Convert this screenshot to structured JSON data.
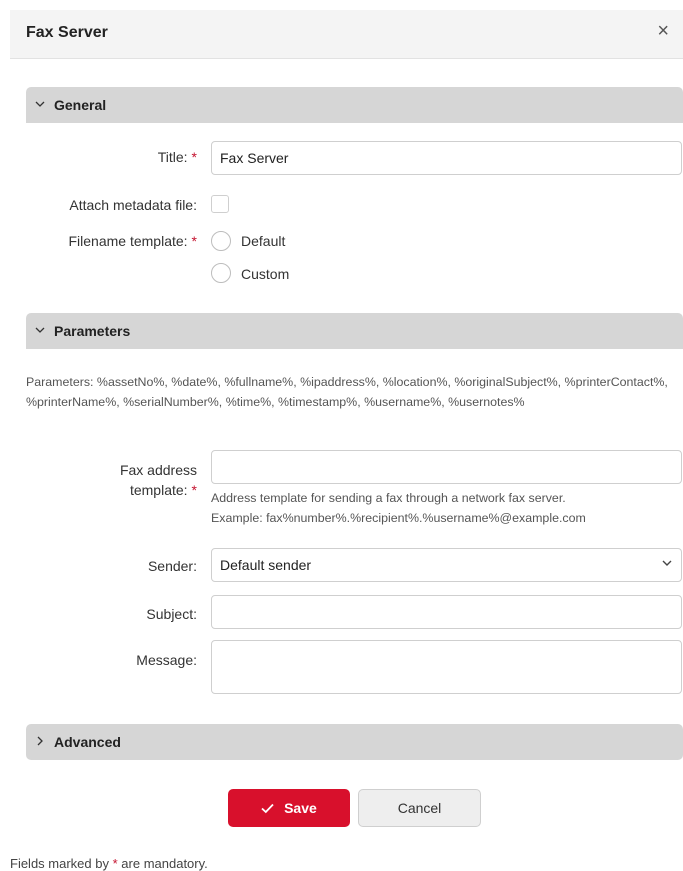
{
  "dialog": {
    "title": "Fax Server",
    "close_symbol": "×"
  },
  "general": {
    "header": "General",
    "title_label": "Title:",
    "title_value": "Fax Server",
    "attach_label": "Attach metadata file:",
    "filename_label": "Filename template:",
    "option_default": "Default",
    "option_custom": "Custom"
  },
  "parameters": {
    "header": "Parameters",
    "list_text": "Parameters: %assetNo%, %date%, %fullname%, %ipaddress%, %location%, %originalSubject%, %printerContact%, %printerName%, %serialNumber%, %time%, %timestamp%, %username%, %usernotes%",
    "fax_label_line1": "Fax address",
    "fax_label_line2": "template:",
    "fax_value": "",
    "fax_hint_line1": "Address template for sending a fax through a network fax server.",
    "fax_hint_line2": "Example: fax%number%.%recipient%.%username%@example.com",
    "sender_label": "Sender:",
    "sender_value": "Default sender",
    "subject_label": "Subject:",
    "subject_value": "",
    "message_label": "Message:",
    "message_value": ""
  },
  "advanced": {
    "header": "Advanced"
  },
  "buttons": {
    "save": "Save",
    "cancel": "Cancel"
  },
  "footer": {
    "note_prefix": "Fields marked by",
    "note_star": "*",
    "note_suffix": "are mandatory."
  },
  "required_marker": "*",
  "colors": {
    "accent": "#d8102c",
    "required": "#c4122f",
    "section_bg": "#d6d6d6",
    "header_bg": "#f4f4f4"
  },
  "icons": {
    "close": "close-icon",
    "section_expanded": "chevron-down-icon",
    "section_collapsed": "chevron-right-icon",
    "save": "check-icon",
    "select": "chevron-down-icon"
  }
}
